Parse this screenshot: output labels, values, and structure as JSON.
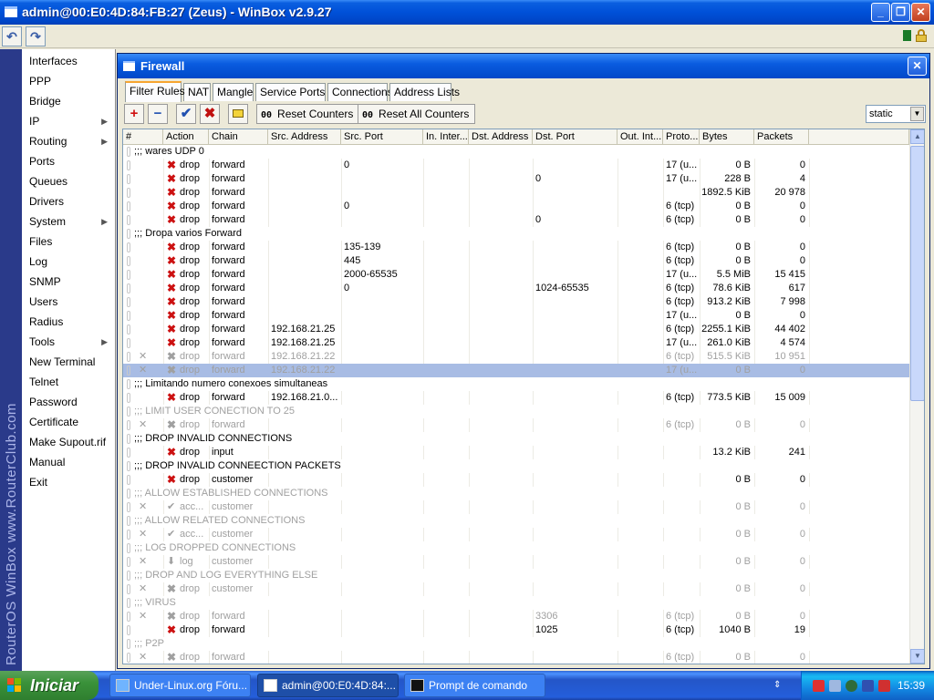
{
  "window": {
    "title": "admin@00:E0:4D:84:FB:27 (Zeus) - WinBox v2.9.27"
  },
  "brand": {
    "text": "RouterOS WinBox   www.RouterClub.com"
  },
  "sidebar": {
    "items": [
      {
        "label": "Interfaces",
        "submenu": false
      },
      {
        "label": "PPP",
        "submenu": false
      },
      {
        "label": "Bridge",
        "submenu": false
      },
      {
        "label": "IP",
        "submenu": true
      },
      {
        "label": "Routing",
        "submenu": true
      },
      {
        "label": "Ports",
        "submenu": false
      },
      {
        "label": "Queues",
        "submenu": false
      },
      {
        "label": "Drivers",
        "submenu": false
      },
      {
        "label": "System",
        "submenu": true
      },
      {
        "label": "Files",
        "submenu": false
      },
      {
        "label": "Log",
        "submenu": false
      },
      {
        "label": "SNMP",
        "submenu": false
      },
      {
        "label": "Users",
        "submenu": false
      },
      {
        "label": "Radius",
        "submenu": false
      },
      {
        "label": "Tools",
        "submenu": true
      },
      {
        "label": "New Terminal",
        "submenu": false
      },
      {
        "label": "Telnet",
        "submenu": false
      },
      {
        "label": "Password",
        "submenu": false
      },
      {
        "label": "Certificate",
        "submenu": false
      },
      {
        "label": "Make Supout.rif",
        "submenu": false
      },
      {
        "label": "Manual",
        "submenu": false
      },
      {
        "label": "Exit",
        "submenu": false
      }
    ],
    "submenu_arrow": "▶"
  },
  "firewall": {
    "title": "Firewall",
    "tabs": [
      "Filter Rules",
      "NAT",
      "Mangle",
      "Service Ports",
      "Connections",
      "Address Lists"
    ],
    "toolbar": {
      "reset_counters_prefix": "00",
      "reset_counters": "Reset Counters",
      "reset_all_prefix": "00",
      "reset_all": "Reset All Counters",
      "filter_value": "static"
    },
    "columns": [
      "#",
      "Action",
      "Chain",
      "Src. Address",
      "Src. Port",
      "In. Inter...",
      "Dst. Address",
      "Dst. Port",
      "Out. Int...",
      "Proto...",
      "Bytes",
      "Packets"
    ],
    "rows": [
      {
        "type": "comment",
        "text": ";;; wares UDP 0"
      },
      {
        "action": "drop",
        "chain": "forward",
        "src": "",
        "sport": "0",
        "dport": "",
        "proto": "17 (u...",
        "bytes": "0 B",
        "packets": "0"
      },
      {
        "action": "drop",
        "chain": "forward",
        "src": "",
        "sport": "",
        "dport": "0",
        "proto": "17 (u...",
        "bytes": "228 B",
        "packets": "4"
      },
      {
        "action": "drop",
        "chain": "forward",
        "src": "",
        "sport": "",
        "dport": "",
        "proto": "",
        "bytes": "1892.5 KiB",
        "packets": "20 978"
      },
      {
        "action": "drop",
        "chain": "forward",
        "src": "",
        "sport": "0",
        "dport": "",
        "proto": "6 (tcp)",
        "bytes": "0 B",
        "packets": "0"
      },
      {
        "action": "drop",
        "chain": "forward",
        "src": "",
        "sport": "",
        "dport": "0",
        "proto": "6 (tcp)",
        "bytes": "0 B",
        "packets": "0"
      },
      {
        "type": "comment",
        "text": ";;; Dropa varios Forward"
      },
      {
        "action": "drop",
        "chain": "forward",
        "src": "",
        "sport": "135-139",
        "dport": "",
        "proto": "6 (tcp)",
        "bytes": "0 B",
        "packets": "0"
      },
      {
        "action": "drop",
        "chain": "forward",
        "src": "",
        "sport": "445",
        "dport": "",
        "proto": "6 (tcp)",
        "bytes": "0 B",
        "packets": "0"
      },
      {
        "action": "drop",
        "chain": "forward",
        "src": "",
        "sport": "2000-65535",
        "dport": "",
        "proto": "17 (u...",
        "bytes": "5.5 MiB",
        "packets": "15 415"
      },
      {
        "action": "drop",
        "chain": "forward",
        "src": "",
        "sport": "0",
        "dport": "1024-65535",
        "proto": "6 (tcp)",
        "bytes": "78.6 KiB",
        "packets": "617"
      },
      {
        "action": "drop",
        "chain": "forward",
        "src": "",
        "sport": "",
        "dport": "",
        "proto": "6 (tcp)",
        "bytes": "913.2 KiB",
        "packets": "7 998"
      },
      {
        "action": "drop",
        "chain": "forward",
        "src": "",
        "sport": "",
        "dport": "",
        "proto": "17 (u...",
        "bytes": "0 B",
        "packets": "0"
      },
      {
        "action": "drop",
        "chain": "forward",
        "src": "192.168.21.25",
        "sport": "",
        "dport": "",
        "proto": "6 (tcp)",
        "bytes": "2255.1 KiB",
        "packets": "44 402"
      },
      {
        "action": "drop",
        "chain": "forward",
        "src": "192.168.21.25",
        "sport": "",
        "dport": "",
        "proto": "17 (u...",
        "bytes": "261.0 KiB",
        "packets": "4 574"
      },
      {
        "action": "drop",
        "chain": "forward",
        "src": "192.168.21.22",
        "sport": "",
        "dport": "",
        "proto": "6 (tcp)",
        "bytes": "515.5 KiB",
        "packets": "10 951",
        "disabled": true
      },
      {
        "action": "drop",
        "chain": "forward",
        "src": "192.168.21.22",
        "sport": "",
        "dport": "",
        "proto": "17 (u...",
        "bytes": "0 B",
        "packets": "0",
        "disabled": true,
        "selected": true
      },
      {
        "type": "comment",
        "text": ";;; Limitando numero conexoes simultaneas"
      },
      {
        "action": "drop",
        "chain": "forward",
        "src": "192.168.21.0...",
        "sport": "",
        "dport": "",
        "proto": "6 (tcp)",
        "bytes": "773.5 KiB",
        "packets": "15 009"
      },
      {
        "type": "comment",
        "text": ";;; LIMIT USER CONECTION TO 25",
        "disabled": true
      },
      {
        "action": "drop",
        "chain": "forward",
        "src": "",
        "sport": "",
        "dport": "",
        "proto": "6 (tcp)",
        "bytes": "0 B",
        "packets": "0",
        "disabled": true
      },
      {
        "type": "comment",
        "text": ";;; DROP INVALID CONNECTIONS"
      },
      {
        "action": "drop",
        "chain": "input",
        "src": "",
        "sport": "",
        "dport": "",
        "proto": "",
        "bytes": "13.2 KiB",
        "packets": "241"
      },
      {
        "type": "comment",
        "text": ";;; DROP INVALID CONNEECTION PACKETS"
      },
      {
        "action": "drop",
        "chain": "customer",
        "src": "",
        "sport": "",
        "dport": "",
        "proto": "",
        "bytes": "0 B",
        "packets": "0"
      },
      {
        "type": "comment",
        "text": ";;; ALLOW ESTABLISHED CONNECTIONS",
        "disabled": true
      },
      {
        "action": "acc...",
        "icon": "accept",
        "chain": "customer",
        "src": "",
        "sport": "",
        "dport": "",
        "proto": "",
        "bytes": "0 B",
        "packets": "0",
        "disabled": true
      },
      {
        "type": "comment",
        "text": ";;; ALLOW RELATED CONNECTIONS",
        "disabled": true
      },
      {
        "action": "acc...",
        "icon": "accept",
        "chain": "customer",
        "src": "",
        "sport": "",
        "dport": "",
        "proto": "",
        "bytes": "0 B",
        "packets": "0",
        "disabled": true
      },
      {
        "type": "comment",
        "text": ";;; LOG DROPPED CONNECTIONS",
        "disabled": true
      },
      {
        "action": "log",
        "icon": "log",
        "chain": "customer",
        "src": "",
        "sport": "",
        "dport": "",
        "proto": "",
        "bytes": "0 B",
        "packets": "0",
        "disabled": true
      },
      {
        "type": "comment",
        "text": ";;; DROP AND LOG EVERYTHING ELSE",
        "disabled": true
      },
      {
        "action": "drop",
        "chain": "customer",
        "src": "",
        "sport": "",
        "dport": "",
        "proto": "",
        "bytes": "0 B",
        "packets": "0",
        "disabled": true
      },
      {
        "type": "comment",
        "text": ";;; VIRUS",
        "disabled": true
      },
      {
        "action": "drop",
        "chain": "forward",
        "src": "",
        "sport": "",
        "dport": "3306",
        "proto": "6 (tcp)",
        "bytes": "0 B",
        "packets": "0",
        "disabled": true
      },
      {
        "action": "drop",
        "chain": "forward",
        "src": "",
        "sport": "",
        "dport": "1025",
        "proto": "6 (tcp)",
        "bytes": "1040 B",
        "packets": "19"
      },
      {
        "type": "comment",
        "text": ";;; P2P",
        "disabled": true
      },
      {
        "action": "drop",
        "chain": "forward",
        "src": "",
        "sport": "",
        "dport": "",
        "proto": "6 (tcp)",
        "bytes": "0 B",
        "packets": "0",
        "disabled": true
      }
    ]
  },
  "taskbar": {
    "start_label": "Iniciar",
    "tasks": [
      {
        "label": "Under-Linux.org Fóru...",
        "icon": "ie-icon"
      },
      {
        "label": "admin@00:E0:4D:84:...",
        "icon": "winbox-icon",
        "active": true
      },
      {
        "label": "Prompt de comando",
        "icon": "cmd-icon"
      }
    ],
    "clock": "15:39"
  },
  "colors": {
    "title_blue": "#0050d8",
    "selection": "#a8bce4",
    "drop_red": "#cc1111",
    "disabled_gray": "#a0a0a0"
  }
}
